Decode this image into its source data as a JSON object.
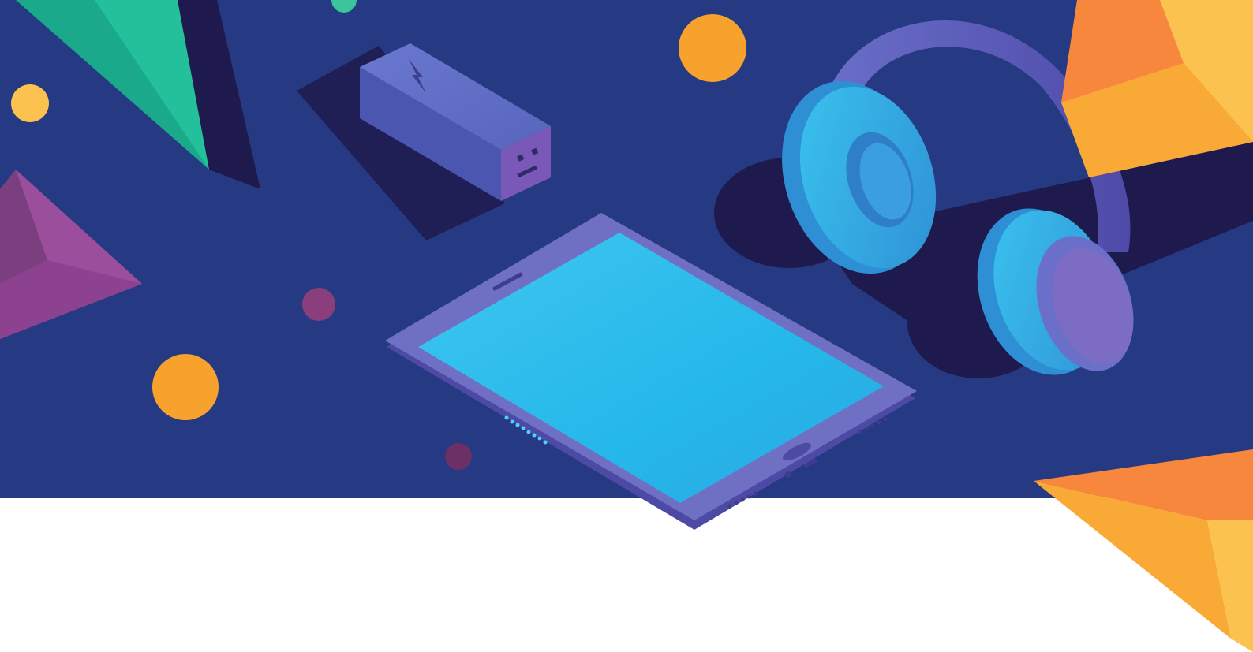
{
  "scene": {
    "description_free": true,
    "palette": {
      "background_top": "#253a83",
      "background_bottom": "#ffffff",
      "tablet_screen": "#2bbdea",
      "tablet_body": "#6f6fc4",
      "headphone_pad": "#35b7ea",
      "headphone_band": "#6b5fb5",
      "power_bank": "#4e58b3",
      "accent_orange": "#f6a22d",
      "accent_yellow": "#fcc24f",
      "accent_green": "#1fb492",
      "accent_purple": "#9a4e9b",
      "accent_plum": "#7e3d77"
    },
    "icons": {
      "power_bank_symbol": "lightning-bolt-icon",
      "power_bank_face": "face-icon"
    }
  }
}
